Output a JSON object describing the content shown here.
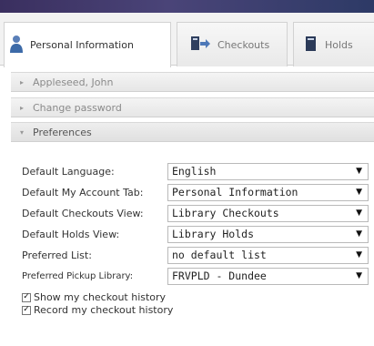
{
  "tabs": [
    {
      "label": "Personal Information",
      "icon": "person-icon",
      "active": true
    },
    {
      "label": "Checkouts",
      "icon": "books-icon",
      "active": false
    },
    {
      "label": "Holds",
      "icon": "book-icon",
      "active": false
    }
  ],
  "sections": {
    "account": "Appleseed, John",
    "password": "Change password",
    "preferences": "Preferences"
  },
  "preferences": [
    {
      "label": "Default Language:",
      "value": "English"
    },
    {
      "label": "Default My Account Tab:",
      "value": "Personal Information"
    },
    {
      "label": "Default Checkouts View:",
      "value": "Library Checkouts"
    },
    {
      "label": "Default Holds View:",
      "value": "Library Holds"
    },
    {
      "label": "Preferred List:",
      "value": "no default list"
    },
    {
      "label": "Preferred Pickup Library:",
      "value": "FRVPLD - Dundee"
    }
  ],
  "checkboxes": [
    {
      "label": "Show my checkout history",
      "checked": true
    },
    {
      "label": "Record my checkout history",
      "checked": true
    }
  ]
}
